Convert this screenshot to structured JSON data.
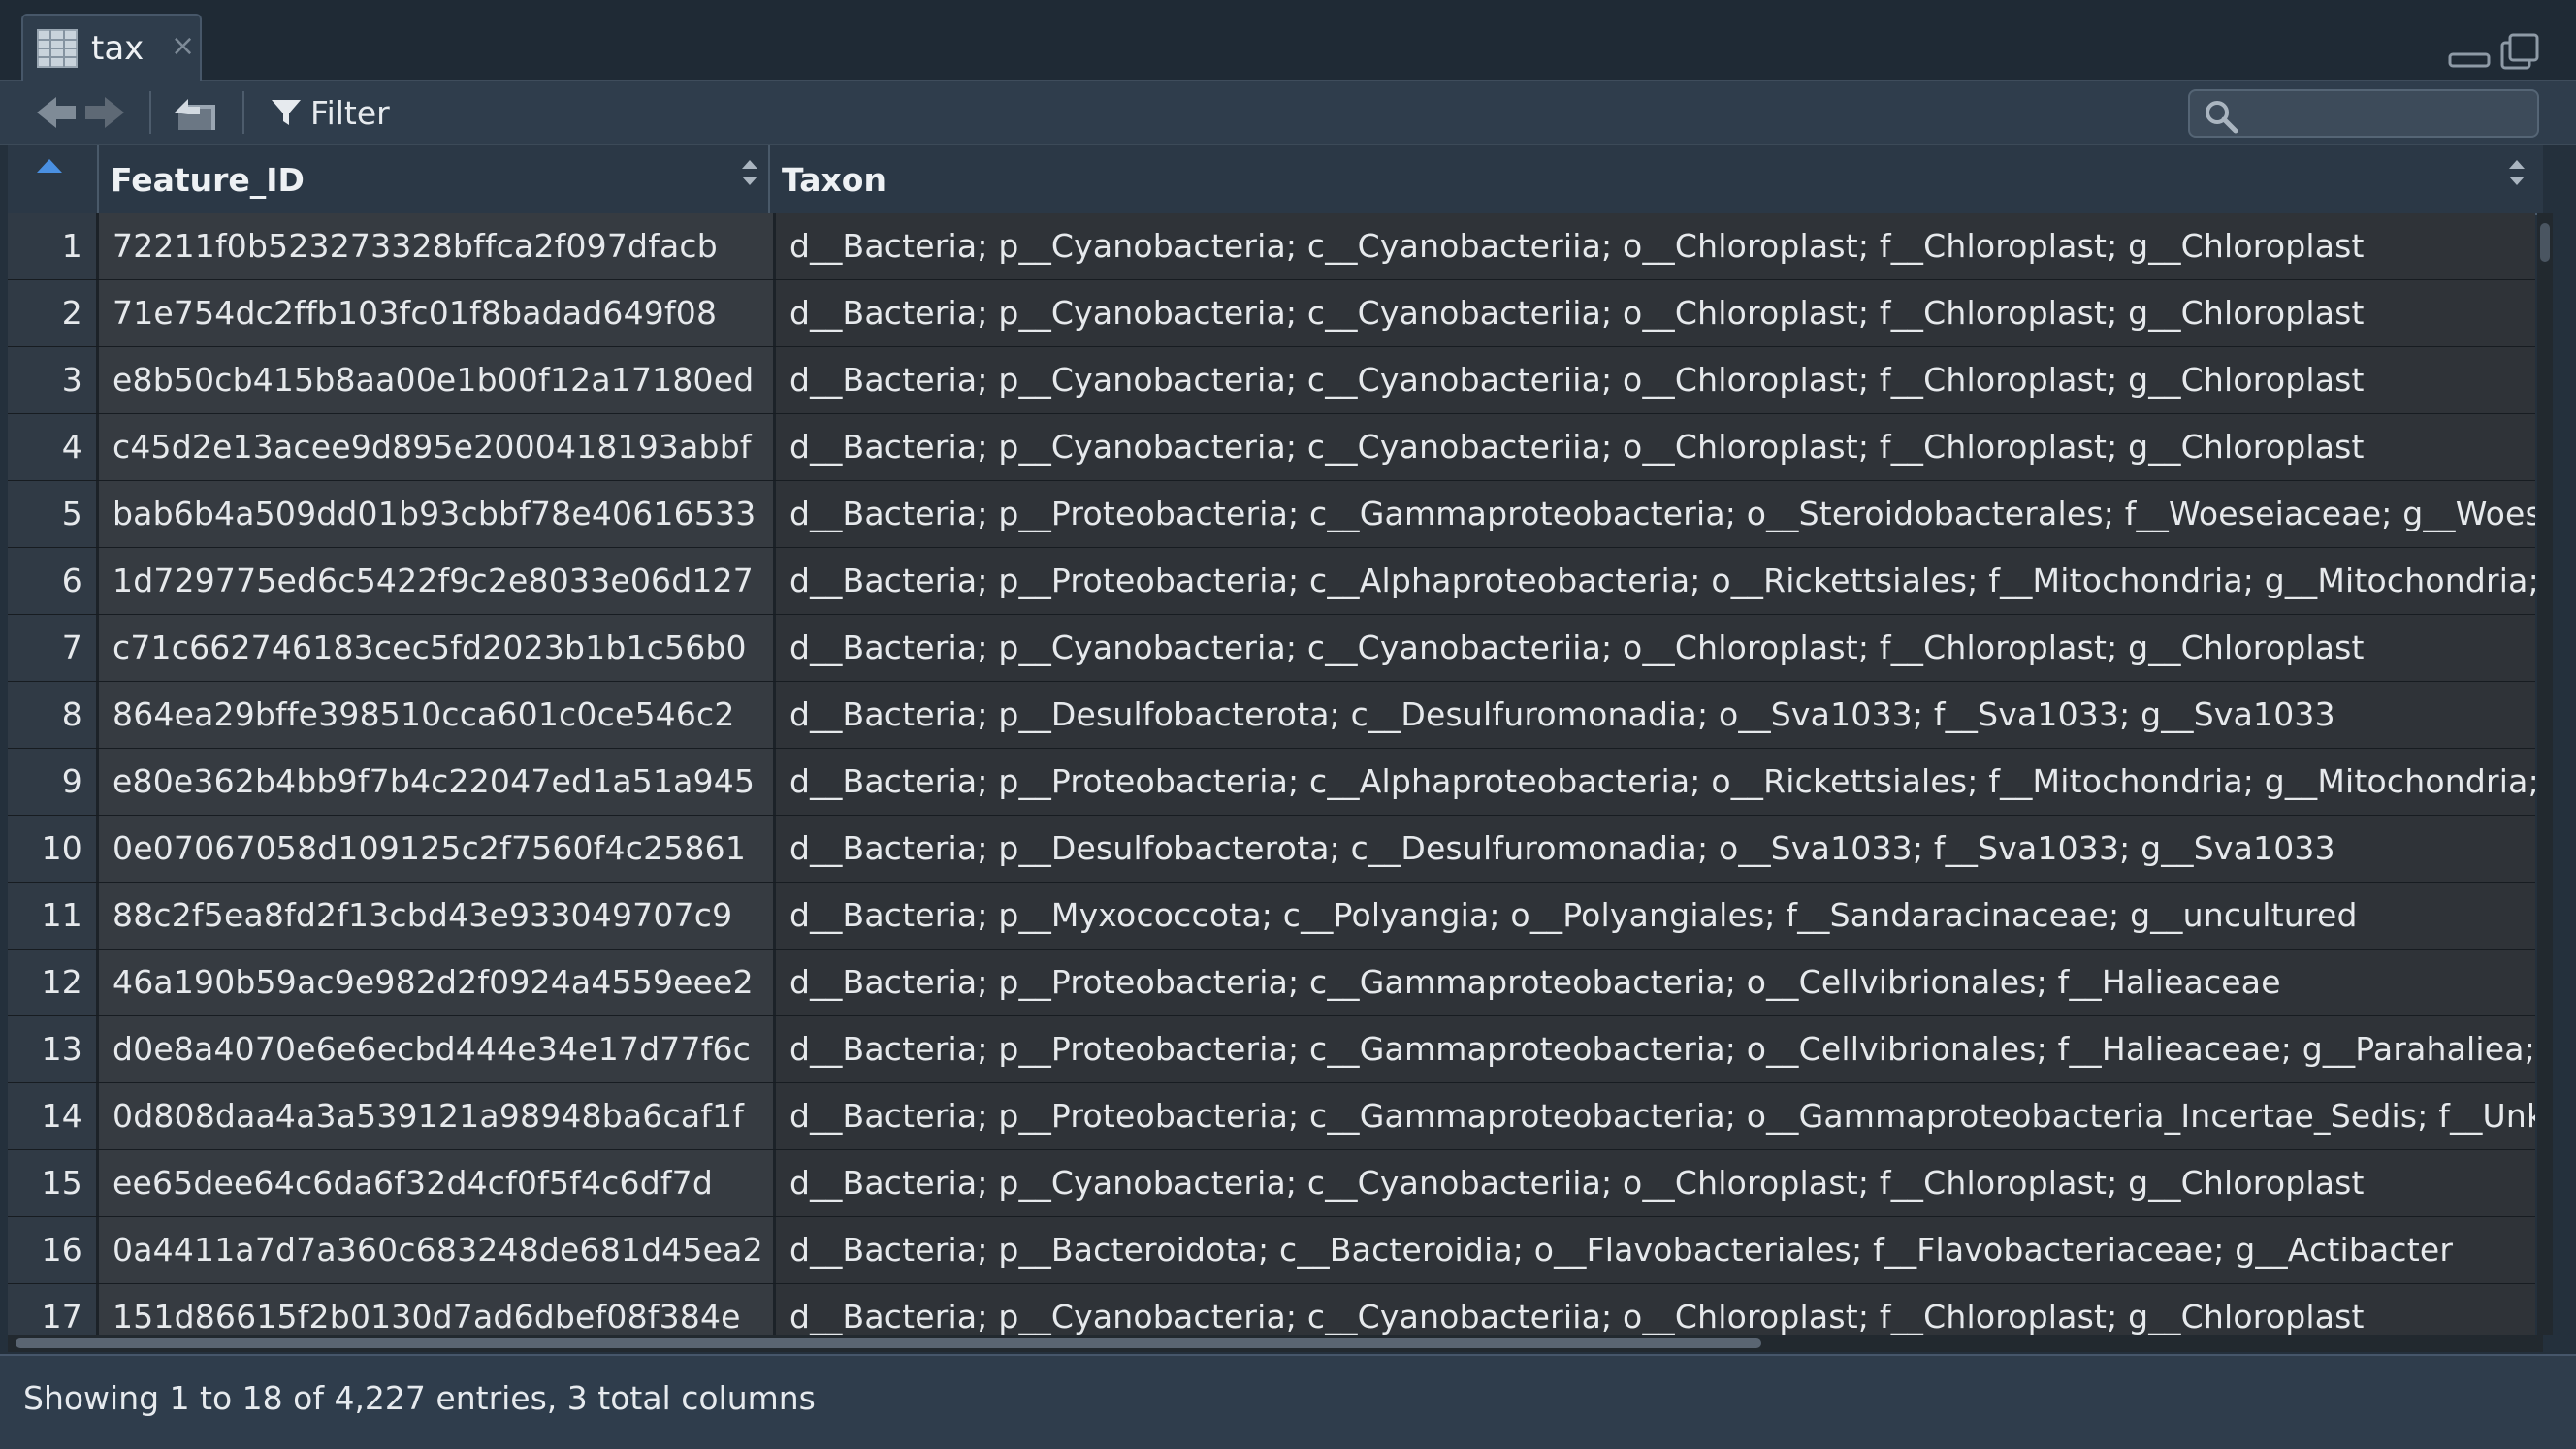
{
  "tab": {
    "title": "tax",
    "close": "×"
  },
  "toolbar": {
    "filter_label": "Filter",
    "search_placeholder": ""
  },
  "columns": [
    {
      "label": ""
    },
    {
      "label": "Feature_ID"
    },
    {
      "label": "Taxon"
    }
  ],
  "rows": [
    {
      "idx": "1",
      "id": "72211f0b523273328bffca2f097dfacb",
      "taxon": "d__Bacteria; p__Cyanobacteria; c__Cyanobacteriia; o__Chloroplast; f__Chloroplast; g__Chloroplast"
    },
    {
      "idx": "2",
      "id": "71e754dc2ffb103fc01f8badad649f08",
      "taxon": "d__Bacteria; p__Cyanobacteria; c__Cyanobacteriia; o__Chloroplast; f__Chloroplast; g__Chloroplast"
    },
    {
      "idx": "3",
      "id": "e8b50cb415b8aa00e1b00f12a17180ed",
      "taxon": "d__Bacteria; p__Cyanobacteria; c__Cyanobacteriia; o__Chloroplast; f__Chloroplast; g__Chloroplast"
    },
    {
      "idx": "4",
      "id": "c45d2e13acee9d895e2000418193abbf",
      "taxon": "d__Bacteria; p__Cyanobacteria; c__Cyanobacteriia; o__Chloroplast; f__Chloroplast; g__Chloroplast"
    },
    {
      "idx": "5",
      "id": "bab6b4a509dd01b93cbbf78e40616533",
      "taxon": "d__Bacteria; p__Proteobacteria; c__Gammaproteobacteria; o__Steroidobacterales; f__Woeseiaceae; g__Woeseia"
    },
    {
      "idx": "6",
      "id": "1d729775ed6c5422f9c2e8033e06d127",
      "taxon": "d__Bacteria; p__Proteobacteria; c__Alphaproteobacteria; o__Rickettsiales; f__Mitochondria; g__Mitochondria; s__u"
    },
    {
      "idx": "7",
      "id": "c71c662746183cec5fd2023b1b1c56b0",
      "taxon": "d__Bacteria; p__Cyanobacteria; c__Cyanobacteriia; o__Chloroplast; f__Chloroplast; g__Chloroplast"
    },
    {
      "idx": "8",
      "id": "864ea29bffe398510cca601c0ce546c2",
      "taxon": "d__Bacteria; p__Desulfobacterota; c__Desulfuromonadia; o__Sva1033; f__Sva1033; g__Sva1033"
    },
    {
      "idx": "9",
      "id": "e80e362b4bb9f7b4c22047ed1a51a945",
      "taxon": "d__Bacteria; p__Proteobacteria; c__Alphaproteobacteria; o__Rickettsiales; f__Mitochondria; g__Mitochondria; s__u"
    },
    {
      "idx": "10",
      "id": "0e07067058d109125c2f7560f4c25861",
      "taxon": "d__Bacteria; p__Desulfobacterota; c__Desulfuromonadia; o__Sva1033; f__Sva1033; g__Sva1033"
    },
    {
      "idx": "11",
      "id": "88c2f5ea8fd2f13cbd43e933049707c9",
      "taxon": "d__Bacteria; p__Myxococcota; c__Polyangia; o__Polyangiales; f__Sandaracinaceae; g__uncultured"
    },
    {
      "idx": "12",
      "id": "46a190b59ac9e982d2f0924a4559eee2",
      "taxon": "d__Bacteria; p__Proteobacteria; c__Gammaproteobacteria; o__Cellvibrionales; f__Halieaceae"
    },
    {
      "idx": "13",
      "id": "d0e8a4070e6e6ecbd444e34e17d77f6c",
      "taxon": "d__Bacteria; p__Proteobacteria; c__Gammaproteobacteria; o__Cellvibrionales; f__Halieaceae; g__Parahaliea; s__un"
    },
    {
      "idx": "14",
      "id": "0d808daa4a3a539121a98948ba6caf1f",
      "taxon": "d__Bacteria; p__Proteobacteria; c__Gammaproteobacteria; o__Gammaproteobacteria_Incertae_Sedis; f__Unknown"
    },
    {
      "idx": "15",
      "id": "ee65dee64c6da6f32d4cf0f5f4c6df7d",
      "taxon": "d__Bacteria; p__Cyanobacteria; c__Cyanobacteriia; o__Chloroplast; f__Chloroplast; g__Chloroplast"
    },
    {
      "idx": "16",
      "id": "0a4411a7d7a360c683248de681d45ea2",
      "taxon": "d__Bacteria; p__Bacteroidota; c__Bacteroidia; o__Flavobacteriales; f__Flavobacteriaceae; g__Actibacter"
    },
    {
      "idx": "17",
      "id": "151d86615f2b0130d7ad6dbef08f384e",
      "taxon": "d__Bacteria; p__Cyanobacteria; c__Cyanobacteriia; o__Chloroplast; f__Chloroplast; g__Chloroplast"
    }
  ],
  "status": {
    "text": "Showing 1 to 18 of 4,227 entries, 3 total columns"
  },
  "icons": {
    "grid": "grid-icon",
    "close": "close-icon",
    "back": "back-arrow-icon",
    "forward": "forward-arrow-icon",
    "popout": "popout-icon",
    "filter": "filter-icon",
    "search": "search-icon",
    "sort": "sort-icon",
    "minimize": "minimize-icon",
    "maximize": "maximize-icon"
  },
  "colors": {
    "background": "#24303c",
    "row": "#2f3338",
    "header": "#2b3846",
    "text": "#e6e9ec",
    "accent": "#4a90e2"
  }
}
